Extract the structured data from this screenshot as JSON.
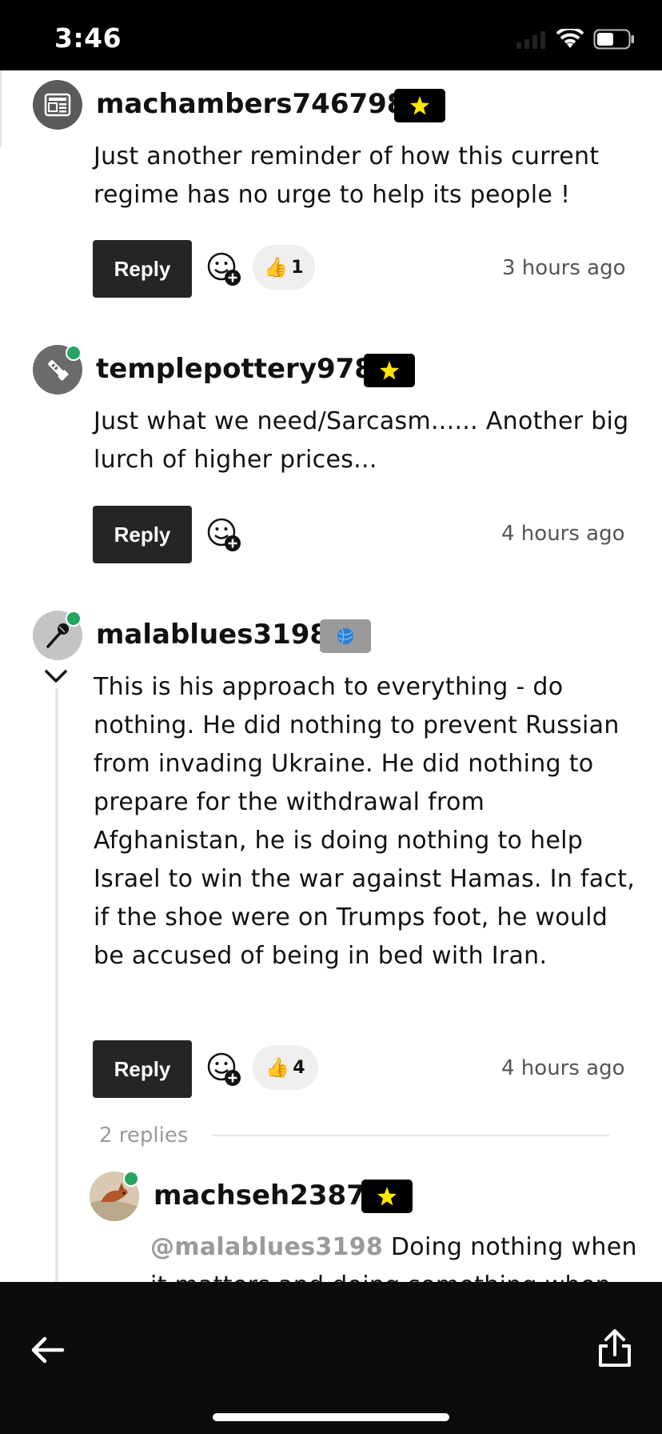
{
  "status_bar": {
    "time": "3:46"
  },
  "comments": [
    {
      "username": "machambers746798",
      "badge": "star-badge",
      "avatar_icon": "newspaper-icon",
      "text": "Just another reminder of how this current regime has no urge to help its people !",
      "reply_label": "Reply",
      "reaction": {
        "icon": "thumbs-up-icon",
        "count": "1"
      },
      "timestamp": "3 hours ago"
    },
    {
      "username": "templepottery978",
      "badge": "star-badge",
      "avatar_icon": "flashlight-icon",
      "online": true,
      "text": "Just what we need/Sarcasm...... Another big lurch of higher prices...",
      "reply_label": "Reply",
      "timestamp": "4 hours ago"
    },
    {
      "username": "malablues3198",
      "badge": "yarn-ball-badge",
      "avatar_icon": "microphone-icon",
      "online": true,
      "text": "This is his approach to everything - do nothing. He did nothing to prevent Russian from invading Ukraine. He did nothing to prepare for the withdrawal from Afghanistan, he is doing nothing to help Israel to win the war against Hamas. In fact, if the shoe were on Trumps foot, he would be accused of being in bed with Iran.",
      "reply_label": "Reply",
      "reaction": {
        "icon": "thumbs-up-icon",
        "count": "4"
      },
      "timestamp": "4 hours ago",
      "replies_label": "2 replies"
    }
  ],
  "reply": {
    "username": "machseh2387",
    "badge": "star-badge",
    "online": true,
    "mention": "@malablues3198",
    "text": " Doing nothing when it matters and doing something when"
  },
  "colors": {
    "accent_online": "#25a55f",
    "button_bg": "#252525",
    "badge_star": "#ffe600"
  }
}
